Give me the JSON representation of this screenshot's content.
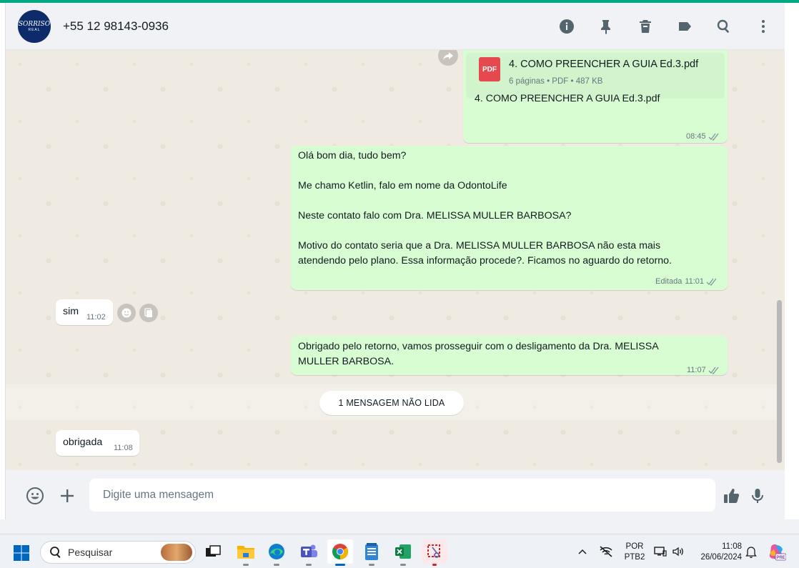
{
  "colors": {
    "accent": "#00a884",
    "outgoing_bubble": "#d9fdd3",
    "incoming_bubble": "#ffffff",
    "chat_background": "#efeae2",
    "pdf_badge": "#e5484d"
  },
  "header": {
    "avatar": {
      "logo_line1": "SORRISO",
      "logo_line2": "REAL"
    },
    "contact_name": "+55 12 98143-0936",
    "icons": [
      "info-icon",
      "pin-icon",
      "delete-icon",
      "label-icon",
      "search-icon",
      "menu-icon"
    ]
  },
  "messages": {
    "document": {
      "badge": "PDF",
      "title": "4. COMO PREENCHER A GUIA Ed.3.pdf",
      "info": "6 páginas • PDF • 487 KB",
      "caption": "4. COMO PREENCHER A GUIA Ed.3.pdf",
      "time": "08:45"
    },
    "outgoing_intro": {
      "lines": [
        "Olá bom dia, tudo bem?",
        "Me chamo Ketlin, falo em nome da OdontoLife",
        "Neste contato falo com Dra. MELISSA MULLER BARBOSA?",
        "Motivo do contato seria que a Dra. MELISSA MULLER BARBOSA não esta mais",
        "atendendo pelo plano. Essa informação procede?. Ficamos no aguardo do retorno."
      ],
      "edited_label": "Editada",
      "time": "11:01"
    },
    "incoming_sim": {
      "text": "sim",
      "time": "11:02"
    },
    "outgoing_thanks": {
      "line1": "Obrigado pelo retorno, vamos prosseguir com o desligamento da Dra. MELISSA",
      "line2": "MULLER BARBOSA.",
      "time": "11:07"
    },
    "unread_divider": "1 MENSAGEM NÃO LIDA",
    "incoming_obrigada": {
      "text": "obrigada",
      "time": "11:08"
    }
  },
  "composer": {
    "placeholder": "Digite uma mensagem",
    "icons": [
      "emoji-icon",
      "plus-icon",
      "thumbs-up-icon",
      "microphone-icon"
    ]
  },
  "taskbar": {
    "search_label": "Pesquisar",
    "apps": [
      "task-view-icon",
      "file-explorer-icon",
      "edge-icon",
      "teams-icon",
      "chrome-icon",
      "notepad-icon",
      "excel-icon",
      "snipping-tool-icon"
    ],
    "language_line1": "POR",
    "language_line2": "PTB2",
    "time": "11:08",
    "date": "26/06/2024",
    "copilot_badge": "PRE"
  }
}
